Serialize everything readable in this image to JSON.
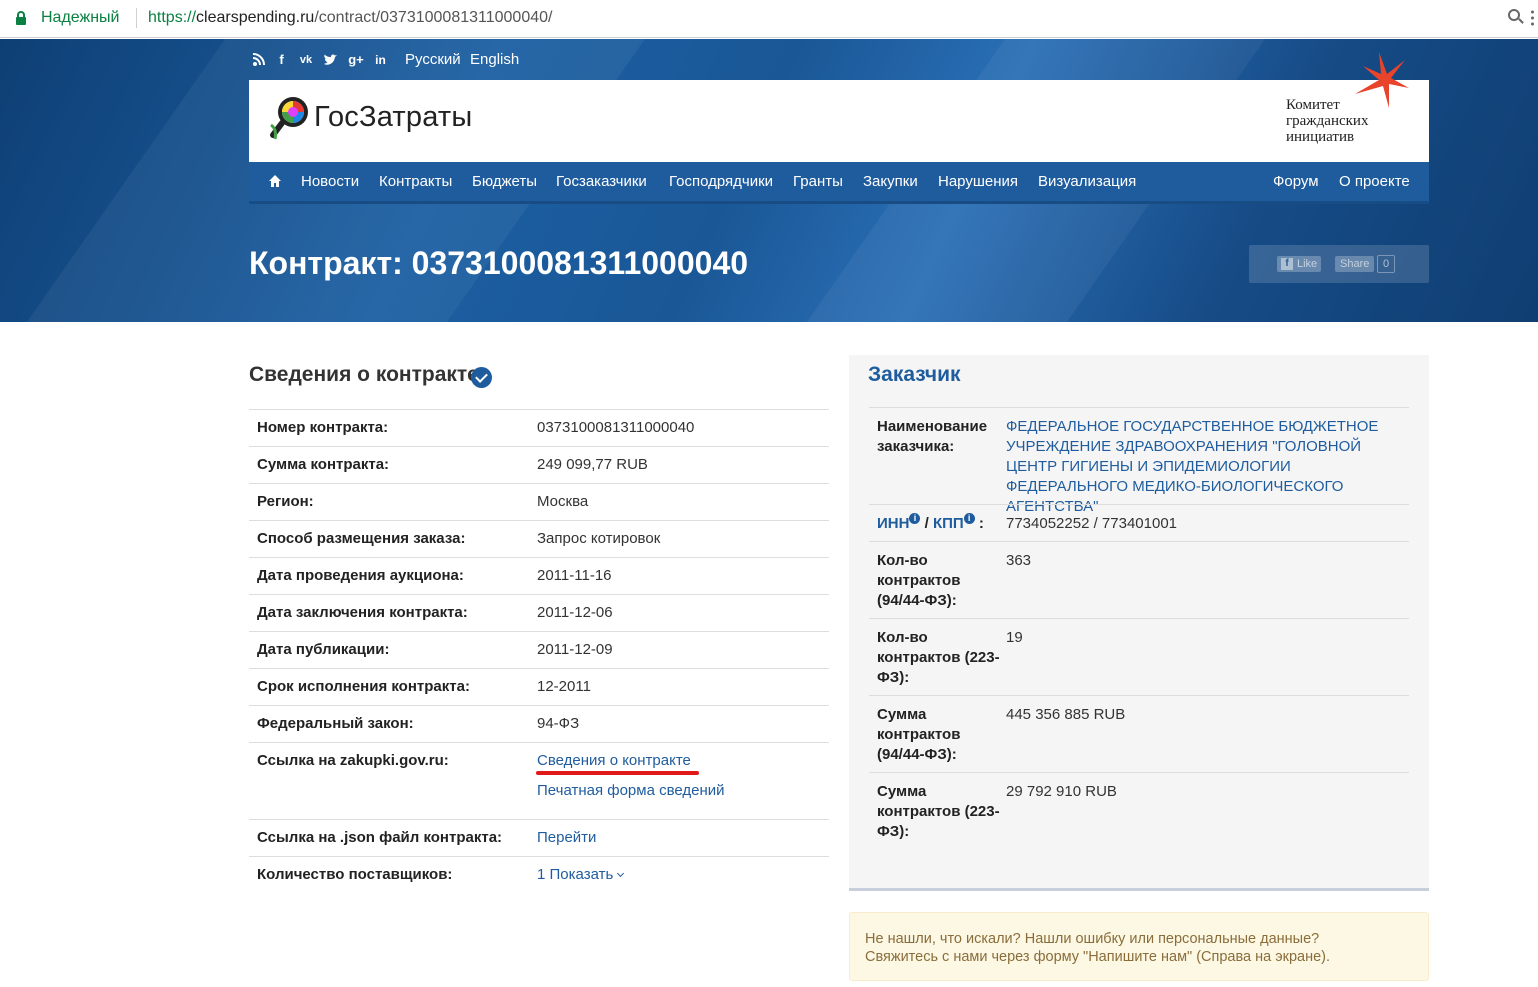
{
  "browser": {
    "secure_label": "Надежный",
    "url_scheme": "https://",
    "url_host": "clearspending.ru",
    "url_path": "/contract/0373100081311000040/"
  },
  "header": {
    "social_icons": [
      "rss-icon",
      "facebook-icon",
      "vk-icon",
      "twitter-icon",
      "google-plus-icon",
      "linkedin-icon"
    ],
    "lang_ru": "Русский",
    "lang_en": "English",
    "logo_text": "ГосЗатраты",
    "partner_line1": "Комитет",
    "partner_line2": "гражданских",
    "partner_line3": "инициатив"
  },
  "nav": {
    "items": [
      "Новости",
      "Контракты",
      "Бюджеты",
      "Госзаказчики",
      "Господрядчики",
      "Гранты",
      "Закупки",
      "Нарушения",
      "Визуализация"
    ],
    "right_items": [
      "Форум",
      "О проекте"
    ]
  },
  "page": {
    "title": "Контракт: 0373100081311000040",
    "fb_like": "Like",
    "fb_share": "Share",
    "fb_count": "0"
  },
  "contract": {
    "section_title": "Сведения о контракте",
    "rows": [
      {
        "label": "Номер контракта:",
        "value": "0373100081311000040"
      },
      {
        "label": "Сумма контракта:",
        "value": "249 099,77 RUB"
      },
      {
        "label": "Регион:",
        "value": "Москва"
      },
      {
        "label": "Способ размещения заказа:",
        "value": "Запрос котировок"
      },
      {
        "label": "Дата проведения аукциона:",
        "value": "2011-11-16"
      },
      {
        "label": "Дата заключения контракта:",
        "value": "2011-12-06"
      },
      {
        "label": "Дата публикации:",
        "value": "2011-12-09"
      },
      {
        "label": "Срок исполнения контракта:",
        "value": "12-2011"
      },
      {
        "label": "Федеральный закон:",
        "value": "94-ФЗ"
      }
    ],
    "zakupki_label": "Ссылка на zakupki.gov.ru:",
    "zakupki_link1": "Сведения о контракте",
    "zakupki_link2": "Печатная форма сведений",
    "json_label": "Ссылка на .json файл контракта:",
    "json_link": "Перейти",
    "suppliers_label": "Количество поставщиков:",
    "suppliers_value": "1 Показать"
  },
  "customer": {
    "title": "Заказчик",
    "name_label": "Наименование заказчика:",
    "name_value": "ФЕДЕРАЛЬНОЕ ГОСУДАРСТВЕННОЕ БЮДЖЕТНОЕ УЧРЕЖДЕНИЕ ЗДРАВООХРАНЕНИЯ \"ГОЛОВНОЙ ЦЕНТР ГИГИЕНЫ И ЭПИДЕМИОЛОГИИ ФЕДЕРАЛЬНОГО МЕДИКО-БИОЛОГИЧЕСКОГО АГЕНТСТВА\"",
    "inn_label": "ИНН",
    "kpp_label": "КПП",
    "inn_kpp_value": "7734052252 / 773401001",
    "count_9444_label": "Кол-во контрактов (94/44-ФЗ):",
    "count_9444_value": "363",
    "count_223_label": "Кол-во контрактов (223-ФЗ):",
    "count_223_value": "19",
    "sum_9444_label": "Сумма контрактов (94/44-ФЗ):",
    "sum_9444_value": "445 356 885 RUB",
    "sum_223_label": "Сумма контрактов (223-ФЗ):",
    "sum_223_value": "29 792 910 RUB"
  },
  "notice": {
    "line1": "Не нашли, что искали? Нашли ошибку или персональные данные?",
    "line2": "Свяжитесь с нами через форму \"Напишите нам\" (Справа на экране)."
  },
  "colors": {
    "accent": "#1f5c9e",
    "secure_green": "#0b8043",
    "highlight_red": "#e01a1a",
    "notice_bg": "#fcf8e3"
  }
}
